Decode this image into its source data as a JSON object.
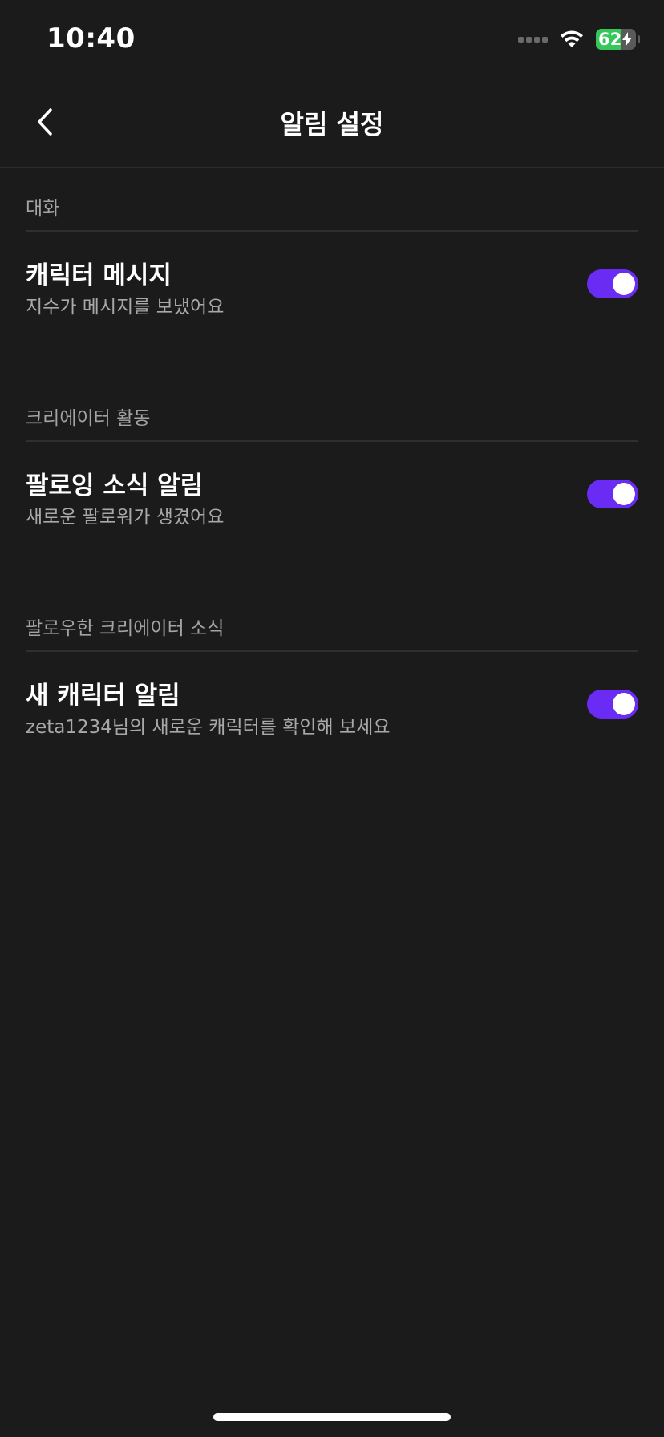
{
  "status_bar": {
    "time": "10:40",
    "battery_percent": "62",
    "battery_level": 62,
    "icons": [
      "cellular-signal-icon",
      "wifi-icon",
      "battery-charging-icon"
    ]
  },
  "header": {
    "title": "알림 설정",
    "back_icon": "chevron-left-icon"
  },
  "sections": [
    {
      "label": "대화",
      "setting": {
        "title": "캐릭터 메시지",
        "description": "지수가 메시지를 보냈어요",
        "enabled": true
      }
    },
    {
      "label": "크리에이터 활동",
      "setting": {
        "title": "팔로잉 소식 알림",
        "description": "새로운 팔로워가 생겼어요",
        "enabled": true
      }
    },
    {
      "label": "팔로우한 크리에이터 소식",
      "setting": {
        "title": "새 캐릭터 알림",
        "description": "zeta1234님의 새로운 캐릭터를 확인해 보세요",
        "enabled": true
      }
    }
  ],
  "colors": {
    "background": "#1b1b1b",
    "toggle_on": "#6a2cf4",
    "battery_green": "#35c759",
    "secondary_text": "#a3a3a3"
  }
}
